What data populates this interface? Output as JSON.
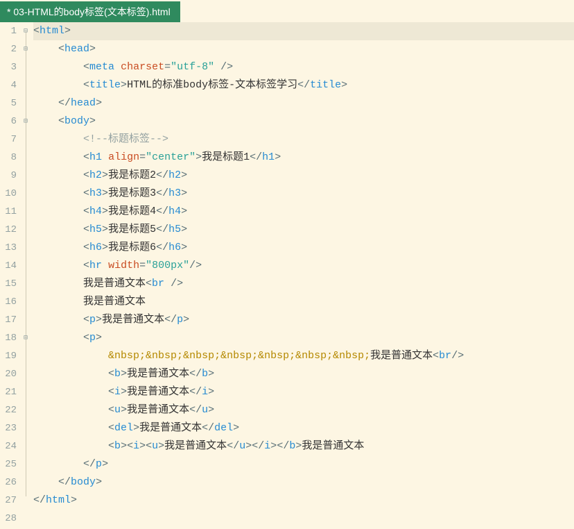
{
  "tab": {
    "title": "* 03-HTML的body标签(文本标签).html"
  },
  "gutter": {
    "l1": "1",
    "l2": "2",
    "l3": "3",
    "l4": "4",
    "l5": "5",
    "l6": "6",
    "l7": "7",
    "l8": "8",
    "l9": "9",
    "l10": "10",
    "l11": "11",
    "l12": "12",
    "l13": "13",
    "l14": "14",
    "l15": "15",
    "l16": "16",
    "l17": "17",
    "l18": "18",
    "l19": "19",
    "l20": "20",
    "l21": "21",
    "l22": "22",
    "l23": "23",
    "l24": "24",
    "l25": "25",
    "l26": "26",
    "l27": "27",
    "l28": "28"
  },
  "fold": {
    "block": "⊟"
  },
  "code": {
    "lt": "<",
    "gt": ">",
    "slash": "/",
    "sp": " ",
    "eq": "=",
    "html": "html",
    "head": "head",
    "meta": "meta",
    "title": "title",
    "body": "body",
    "h1": "h1",
    "h2": "h2",
    "h3": "h3",
    "h4": "h4",
    "h5": "h5",
    "h6": "h6",
    "hr": "hr",
    "br": "br",
    "p": "p",
    "b": "b",
    "i": "i",
    "u": "u",
    "del": "del",
    "charset": "charset",
    "utf8": "\"utf-8\"",
    "align": "align",
    "center": "\"center\"",
    "width": "width",
    "w800": "\"800px\"",
    "title_text": "HTML的标准body标签-文本标签学习",
    "cmt_open": "<!--",
    "cmt_text": "标题标签",
    "cmt_close": "-->",
    "t1": "我是标题1",
    "t2": "我是标题2",
    "t3": "我是标题3",
    "t4": "我是标题4",
    "t5": "我是标题5",
    "t6": "我是标题6",
    "plain": "我是普通文本",
    "nbsp": "&nbsp;"
  }
}
